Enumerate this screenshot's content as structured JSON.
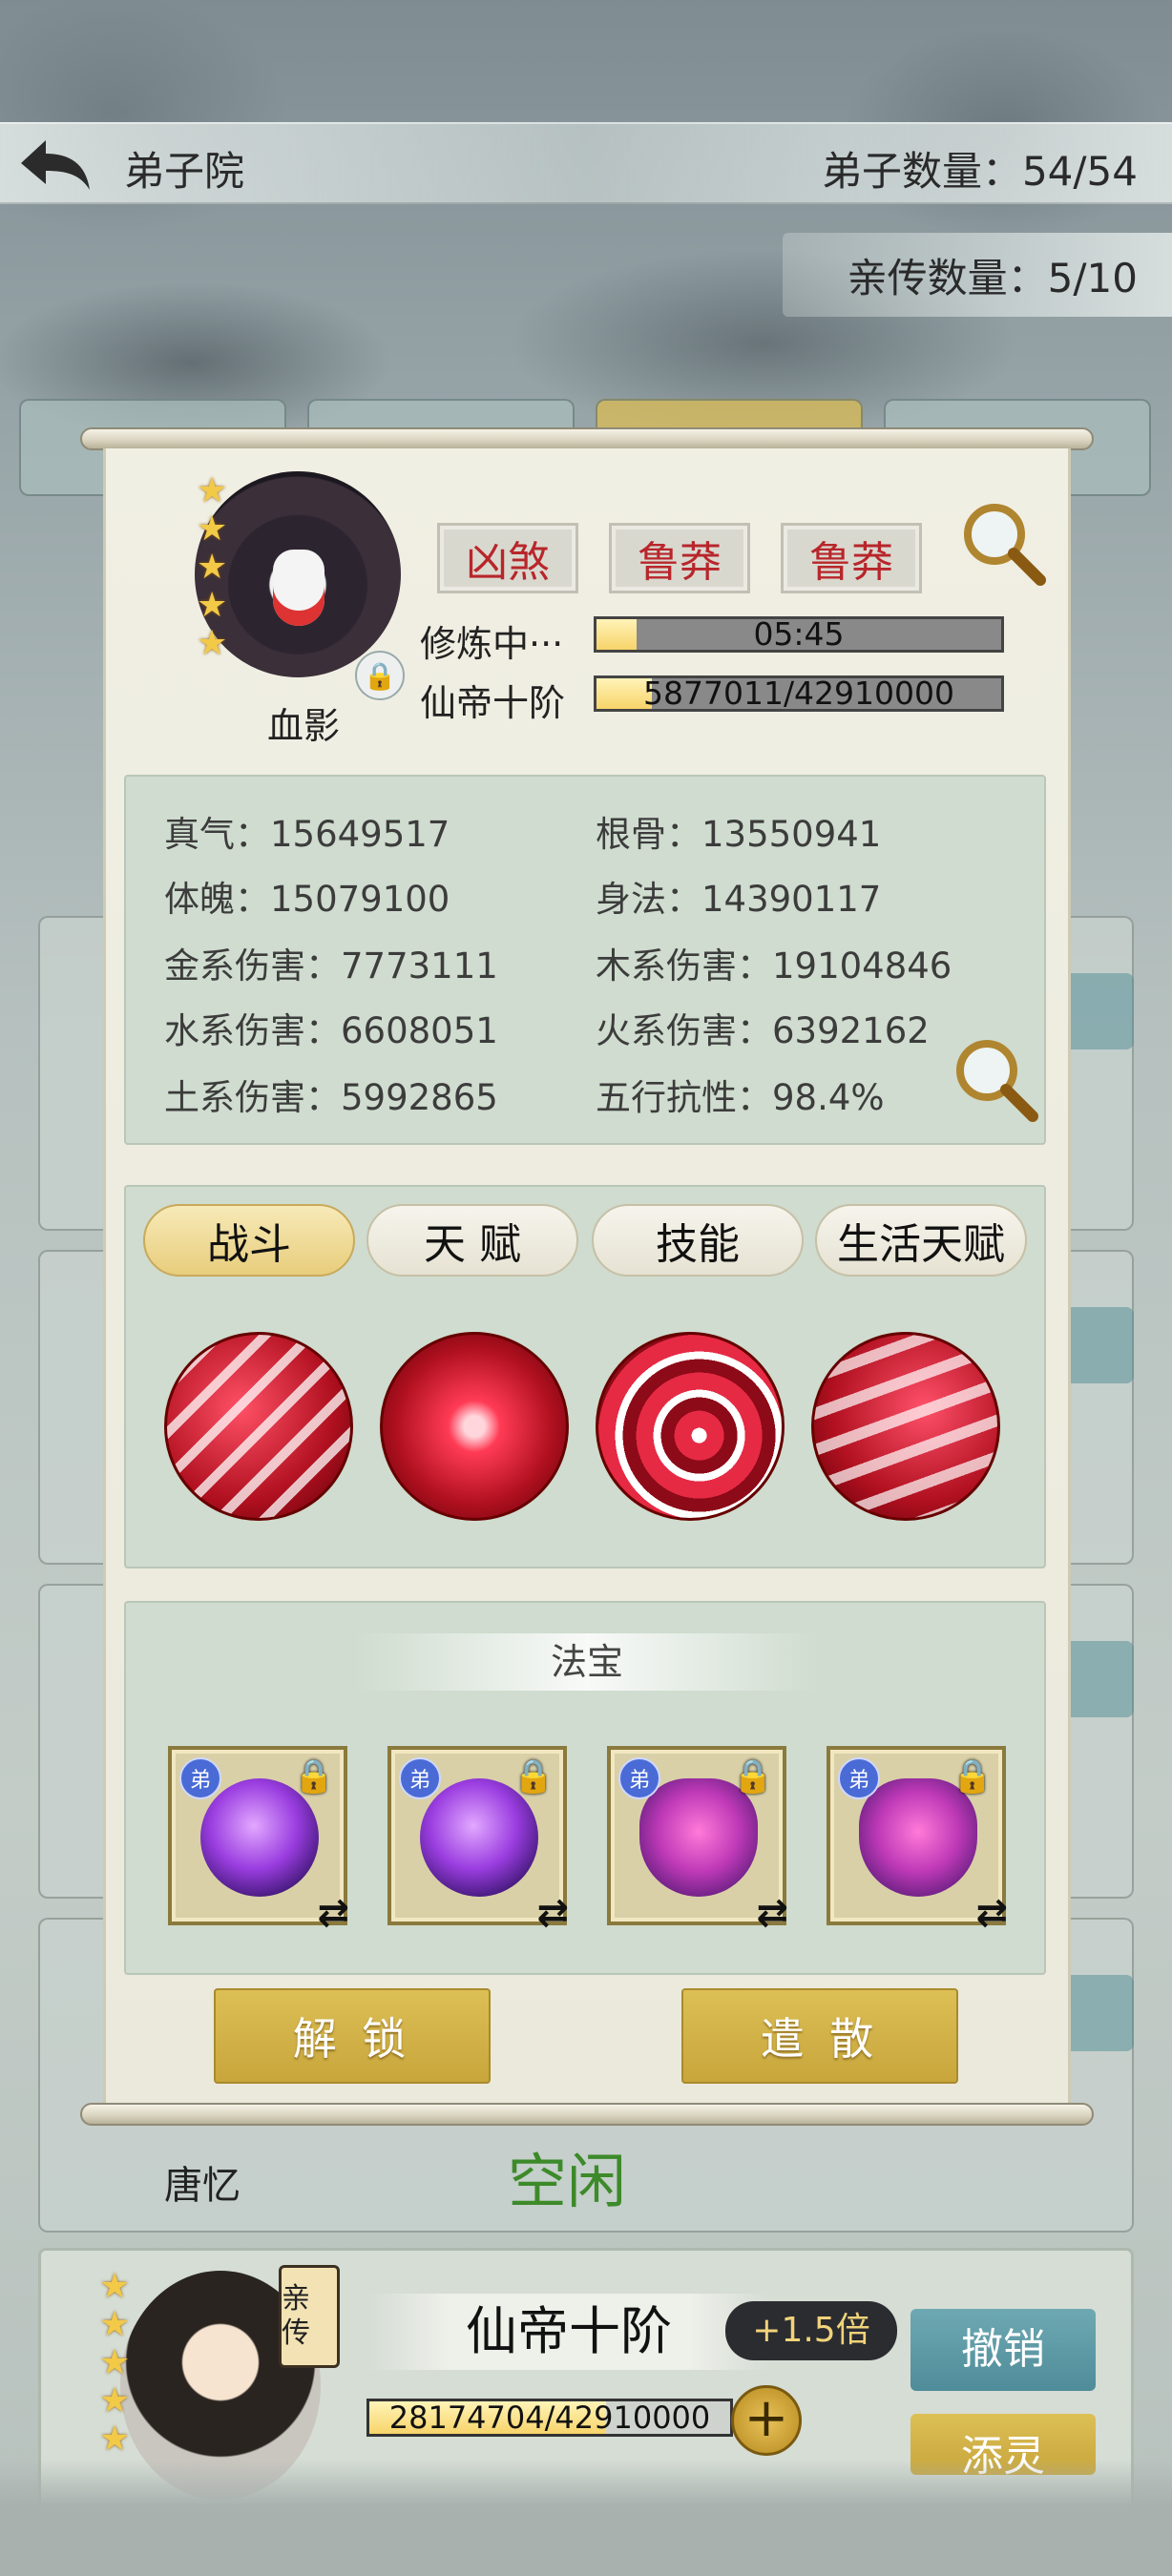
{
  "header": {
    "title": "弟子院",
    "disciple_count": "弟子数量：54/54",
    "inner_count": "亲传数量：5/10"
  },
  "modal": {
    "character": {
      "name": "血影",
      "stars": 5,
      "traits": [
        "凶煞",
        "鲁莽",
        "鲁莽"
      ],
      "status_label": "修炼中···",
      "timer": "05:45",
      "timer_progress": 0.1,
      "realm": "仙帝十阶",
      "exp_text": "5877011/42910000",
      "exp_progress": 0.137
    },
    "stats": [
      {
        "text": "真气：15649517"
      },
      {
        "text": "根骨：13550941"
      },
      {
        "text": "体魄：15079100"
      },
      {
        "text": "身法：14390117"
      },
      {
        "text": "金系伤害：7773111"
      },
      {
        "text": "木系伤害：19104846"
      },
      {
        "text": "水系伤害：6608051"
      },
      {
        "text": "火系伤害：6392162"
      },
      {
        "text": "土系伤害：5992865"
      },
      {
        "text": "五行抗性：98.4%"
      }
    ],
    "tabs": [
      {
        "label": "战斗",
        "active": true
      },
      {
        "label": "天 赋",
        "active": false
      },
      {
        "label": "技能",
        "active": false
      },
      {
        "label": "生活天赋",
        "active": false
      }
    ],
    "fabao": {
      "title": "法宝",
      "badge": "弟",
      "items": [
        {
          "style": "orb"
        },
        {
          "style": "orb"
        },
        {
          "style": "vase"
        },
        {
          "style": "vase"
        }
      ]
    },
    "buttons": {
      "unlock": "解 锁",
      "dismiss": "遣 散"
    }
  },
  "background": {
    "peek_name": "唐忆",
    "peek_status": "空闲",
    "disciple_card": {
      "badge": "亲传",
      "realm": "仙帝十阶",
      "multiplier": "+1.5倍",
      "exp_text": "28174704/42910000",
      "exp_progress": 0.657,
      "revoke_button": "撤销",
      "second_button": "添灵"
    }
  },
  "colors": {
    "trait_red": "#b8262b",
    "panel_green": "#cfdccf",
    "gold_button": "#d2b34a",
    "teal_button": "#5f9ba6",
    "status_green": "#3d8a2a"
  }
}
